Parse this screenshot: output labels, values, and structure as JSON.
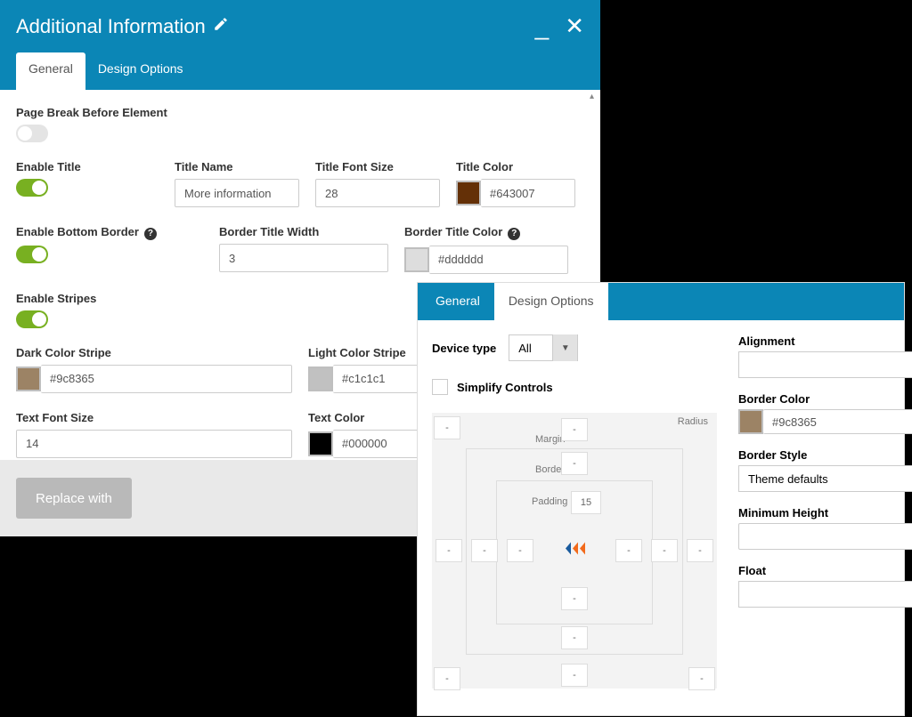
{
  "panel1": {
    "title": "Additional Information",
    "tabs": {
      "general": "General",
      "design": "Design Options"
    },
    "labels": {
      "pageBreak": "Page Break Before Element",
      "enableTitle": "Enable Title",
      "titleName": "Title Name",
      "titleFontSize": "Title Font Size",
      "titleColor": "Title Color",
      "enableBottomBorder": "Enable Bottom Border",
      "borderTitleWidth": "Border Title Width",
      "borderTitleColor": "Border Title Color",
      "enableStripes": "Enable Stripes",
      "darkColorStripe": "Dark Color Stripe",
      "lightColorStripe": "Light Color Stripe",
      "textFontSize": "Text Font Size",
      "textColor": "Text Color"
    },
    "values": {
      "titleName": "More information",
      "titleFontSize": "28",
      "titleColorHex": "#643007",
      "titleColorSwatch": "#643007",
      "borderTitleWidth": "3",
      "borderTitleColorHex": "#dddddd",
      "borderTitleColorSwatch": "#dddddd",
      "darkStripeHex": "#9c8365",
      "darkStripeSwatch": "#9c8365",
      "lightStripeHex": "#c1c1c1",
      "lightStripeSwatch": "#c1c1c1",
      "textFontSize": "14",
      "textColorHex": "#000000",
      "textColorSwatch": "#000000"
    },
    "footer": {
      "replaceWith": "Replace with"
    }
  },
  "panel2": {
    "tabs": {
      "general": "General",
      "design": "Design Options"
    },
    "deviceTypeLabel": "Device type",
    "deviceTypeValue": "All",
    "simplifyControls": "Simplify Controls",
    "boxModel": {
      "radius": "Radius",
      "margin": "Margin",
      "border": "Border",
      "padding": "Padding",
      "dash": "-",
      "paddingTop": "15"
    },
    "right": {
      "alignment": "Alignment",
      "alignmentValue": "",
      "borderColor": "Border Color",
      "borderColorHex": "#9c8365",
      "borderColorSwatch": "#9c8365",
      "borderStyle": "Border Style",
      "borderStyleValue": "Theme defaults",
      "minHeight": "Minimum Height",
      "minHeightValue": "",
      "float": "Float",
      "floatValue": ""
    }
  }
}
